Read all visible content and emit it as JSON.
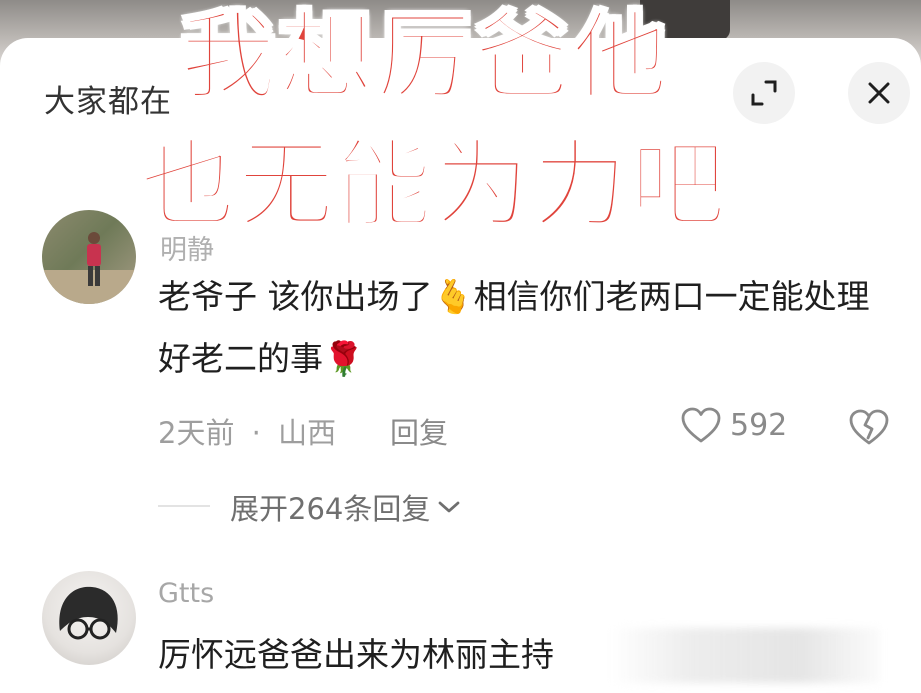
{
  "header": {
    "title": "大家都在"
  },
  "overlay": {
    "line1": "我想厉爸他",
    "line2": "也无能为力吧",
    "color": "#e0443c"
  },
  "comments": [
    {
      "username": "明静",
      "text": "老爷子  该你出场了🫰相信你们老两口一定能处理好老二的事🌹",
      "time": "2天前",
      "separator": "·",
      "location": "山西",
      "reply_label": "回复",
      "likes": "592",
      "expand_replies": "展开264条回复"
    },
    {
      "username": "Gtts",
      "text": "厉怀远爸爸出来为林丽主持"
    }
  ],
  "icons": {
    "expand": "expand-icon",
    "close": "close-icon",
    "like": "heart-icon",
    "dislike": "broken-heart-icon",
    "chevron": "chevron-down-icon"
  }
}
